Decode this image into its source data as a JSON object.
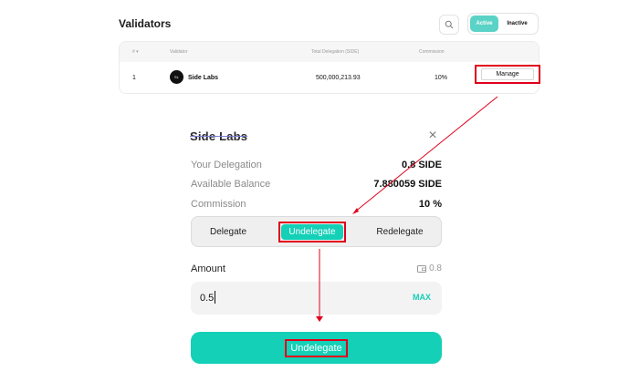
{
  "validators": {
    "title": "Validators",
    "filter": {
      "active": "Active",
      "inactive": "Inactive"
    },
    "columns": [
      "# ▾",
      "Validator",
      "Total Delegation (SIDE)",
      "Commission",
      ""
    ],
    "rows": [
      {
        "index": "1",
        "name": "Side Labs",
        "delegation": "500,000,213.93",
        "commission": "10%",
        "action": "Manage"
      }
    ]
  },
  "modal": {
    "title": "Side Labs",
    "info": [
      {
        "label": "Your Delegation",
        "value": "0.8 SIDE"
      },
      {
        "label": "Available Balance",
        "value": "7.880059 SIDE"
      },
      {
        "label": "Commission",
        "value": "10 %"
      }
    ],
    "tabs": [
      "Delegate",
      "Undelegate",
      "Redelegate"
    ],
    "active_tab": "Undelegate",
    "amount_label": "Amount",
    "balance": "0.8",
    "amount_value": "0.5",
    "max_label": "MAX",
    "submit_label": "Undelegate"
  },
  "colors": {
    "accent": "#13d0b7",
    "annotation": "#e0001b"
  }
}
